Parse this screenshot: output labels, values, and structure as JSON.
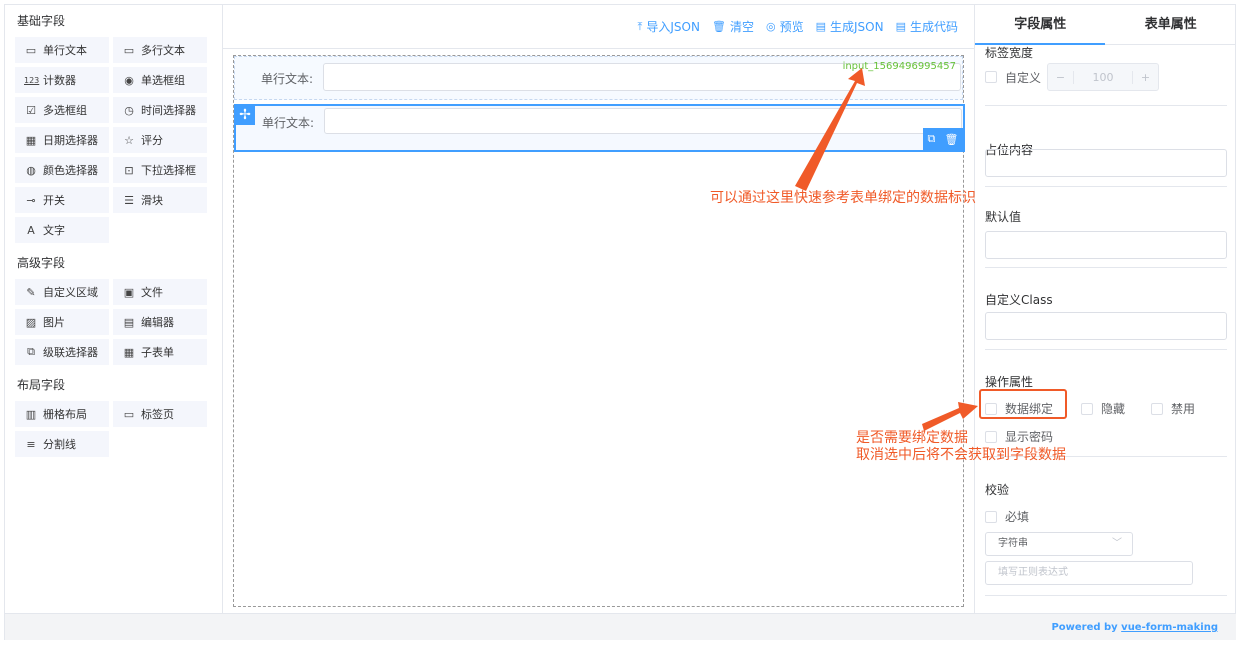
{
  "left": {
    "basic_title": "基础字段",
    "basic_fields": [
      {
        "icon": "input-icon",
        "glyph": "▭",
        "label": "单行文本"
      },
      {
        "icon": "textarea-icon",
        "glyph": "▭",
        "label": "多行文本"
      },
      {
        "icon": "number-icon",
        "glyph": "123",
        "label": "计数器"
      },
      {
        "icon": "radio-icon",
        "glyph": "◉",
        "label": "单选框组"
      },
      {
        "icon": "checkbox-icon",
        "glyph": "☑",
        "label": "多选框组"
      },
      {
        "icon": "clock-icon",
        "glyph": "◷",
        "label": "时间选择器"
      },
      {
        "icon": "calendar-icon",
        "glyph": "▦",
        "label": "日期选择器"
      },
      {
        "icon": "star-icon",
        "glyph": "☆",
        "label": "评分"
      },
      {
        "icon": "palette-icon",
        "glyph": "◍",
        "label": "颜色选择器"
      },
      {
        "icon": "select-icon",
        "glyph": "⊡",
        "label": "下拉选择框"
      },
      {
        "icon": "switch-icon",
        "glyph": "⊸",
        "label": "开关"
      },
      {
        "icon": "slider-icon",
        "glyph": "☰",
        "label": "滑块"
      },
      {
        "icon": "text-icon",
        "glyph": "A",
        "label": "文字"
      }
    ],
    "advanced_title": "高级字段",
    "advanced_fields": [
      {
        "icon": "custom-area-icon",
        "glyph": "✎",
        "label": "自定义区域"
      },
      {
        "icon": "file-icon",
        "glyph": "▣",
        "label": "文件"
      },
      {
        "icon": "image-icon",
        "glyph": "▨",
        "label": "图片"
      },
      {
        "icon": "editor-icon",
        "glyph": "▤",
        "label": "编辑器"
      },
      {
        "icon": "cascader-icon",
        "glyph": "⧉",
        "label": "级联选择器"
      },
      {
        "icon": "table-icon",
        "glyph": "▦",
        "label": "子表单"
      }
    ],
    "layout_title": "布局字段",
    "layout_fields": [
      {
        "icon": "grid-icon",
        "glyph": "▥",
        "label": "栅格布局"
      },
      {
        "icon": "tabs-icon",
        "glyph": "▭",
        "label": "标签页"
      },
      {
        "icon": "divider-icon",
        "glyph": "≡",
        "label": "分割线"
      }
    ]
  },
  "toolbar": {
    "import_json": "导入JSON",
    "clear": "清空",
    "preview": "预览",
    "gen_json": "生成JSON",
    "gen_code": "生成代码"
  },
  "canvas": {
    "row1_label": "单行文本:",
    "row1_model": "input_1569496995457",
    "row2_label": "单行文本:"
  },
  "props": {
    "tab_field": "字段属性",
    "tab_form": "表单属性",
    "label_width": "标签宽度",
    "custom": "自定义",
    "width_value": "100",
    "minus": "−",
    "plus": "+",
    "placeholder_title": "占位内容",
    "default_title": "默认值",
    "class_title": "自定义Class",
    "operation_title": "操作属性",
    "data_bind": "数据绑定",
    "hidden": "隐藏",
    "disabled": "禁用",
    "show_password": "显示密码",
    "validation_title": "校验",
    "required": "必填",
    "type_value": "字符串",
    "regex_placeholder": "填写正则表达式"
  },
  "footer": {
    "powered_by": "Powered by ",
    "link": "vue-form-making"
  },
  "annotations": {
    "a1": "可以通过这里快速参考表单绑定的数据标识",
    "a2_line1": "是否需要绑定数据",
    "a2_line2": "取消选中后将不会获取到字段数据"
  },
  "colors": {
    "accent": "#409eff",
    "annotation": "#f05a28",
    "model_text": "#67c23a"
  }
}
